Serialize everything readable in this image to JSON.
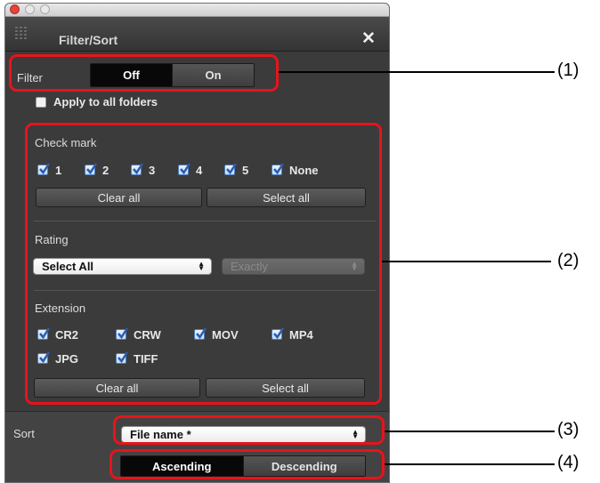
{
  "window": {
    "title": "Filter/Sort",
    "close_symbol": "✕"
  },
  "filter": {
    "label": "Filter",
    "off_label": "Off",
    "on_label": "On",
    "active": "Off"
  },
  "apply_all": {
    "label": "Apply to all folders",
    "checked": false
  },
  "check_mark": {
    "heading": "Check mark",
    "items": [
      {
        "label": "1",
        "checked": true
      },
      {
        "label": "2",
        "checked": true
      },
      {
        "label": "3",
        "checked": true
      },
      {
        "label": "4",
        "checked": true
      },
      {
        "label": "5",
        "checked": true
      },
      {
        "label": "None",
        "checked": true
      }
    ],
    "clear_all": "Clear all",
    "select_all": "Select all"
  },
  "rating": {
    "heading": "Rating",
    "selected": "Select All",
    "mode": "Exactly"
  },
  "extension": {
    "heading": "Extension",
    "items": [
      {
        "label": "CR2",
        "checked": true
      },
      {
        "label": "CRW",
        "checked": true
      },
      {
        "label": "MOV",
        "checked": true
      },
      {
        "label": "MP4",
        "checked": true
      },
      {
        "label": "JPG",
        "checked": true
      },
      {
        "label": "TIFF",
        "checked": true
      }
    ],
    "clear_all": "Clear all",
    "select_all": "Select all"
  },
  "sort": {
    "label": "Sort",
    "selected": "File name *",
    "ascending": "Ascending",
    "descending": "Descending",
    "active": "Ascending"
  },
  "callouts": [
    "(1)",
    "(2)",
    "(3)",
    "(4)"
  ],
  "colors": {
    "panel_bg": "#3b3b3b",
    "callout_red": "#e8131b",
    "check_blue": "#2a5db0"
  }
}
